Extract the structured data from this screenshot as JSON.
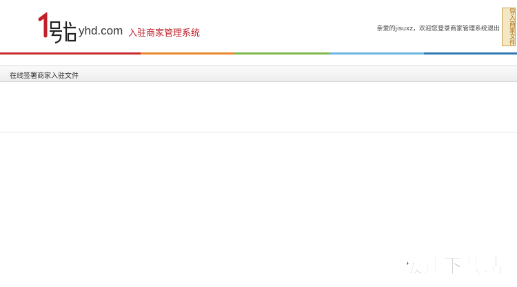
{
  "header": {
    "logo_mark": "1号店",
    "logo_domain": "yhd.com",
    "system_name": "入驻商家管理系统",
    "greeting": "亲爱的jisuxz，欢迎您登录商家管理系统",
    "logout_label": "退出",
    "badge_text": "导入商家文件"
  },
  "colorbar": {
    "colors": [
      "#c9282d",
      "#e9852a",
      "#7db849",
      "#6cb3dd",
      "#2f78b4"
    ]
  },
  "page": {
    "title": "在线签署商家入驻文件"
  },
  "watermark": {
    "text": "极速下载站"
  }
}
